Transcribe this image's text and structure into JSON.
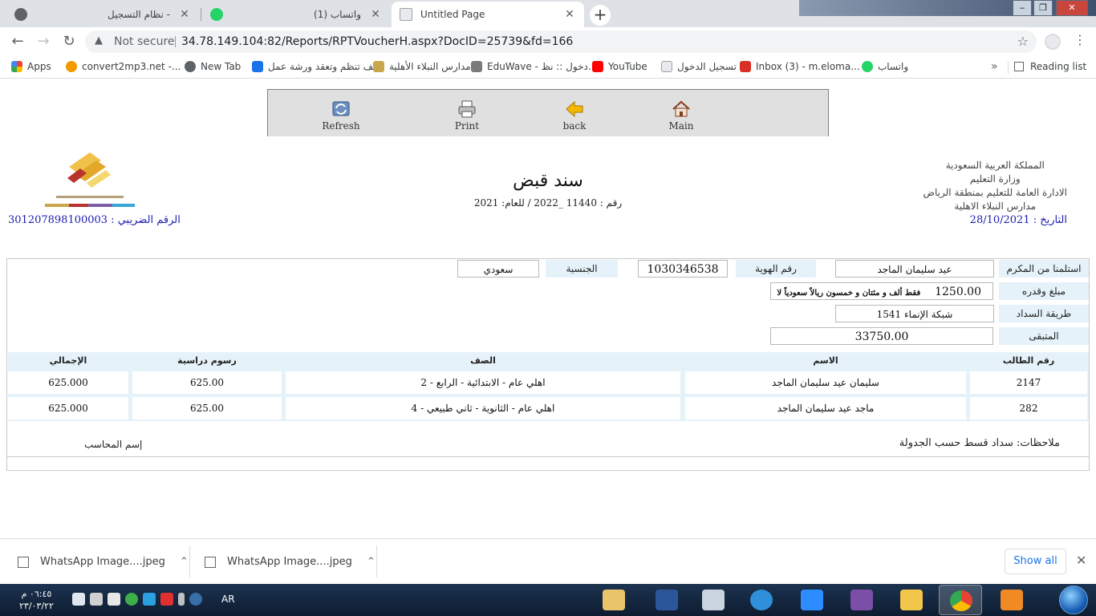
{
  "browser": {
    "tabs": [
      {
        "title": "نظام التسجيل -",
        "favicon_color": "#5f6368"
      },
      {
        "title": "(1) واتساب",
        "favicon_color": "#25d366"
      },
      {
        "title": "Untitled Page",
        "favicon_color": "#8ab4f8"
      }
    ],
    "address": {
      "security": "Not secure",
      "url": "34.78.149.104:82/Reports/RPTVoucherH.aspx?DocID=25739&fd=166"
    },
    "bookmarks": [
      {
        "label": "Apps",
        "color": "#ea4335"
      },
      {
        "label": "convert2mp3.net -...",
        "color": "#f29900"
      },
      {
        "label": "New Tab",
        "color": "#5f6368"
      },
      {
        "label": "كيف تنظم وتعقد ورشة عمل",
        "color": "#1a73e8"
      },
      {
        "label": "مدارس النبلاء الأهلية",
        "color": "#c8a64b"
      },
      {
        "label": "EduWave - دخول :: نظ...",
        "color": "#7a7a7a"
      },
      {
        "label": "YouTube",
        "color": "#ff0000"
      },
      {
        "label": "تسجيل الدخول",
        "color": "#9aa0a6"
      },
      {
        "label": "Inbox (3) - m.eloma...",
        "color": "#d93025"
      },
      {
        "label": "واتساب",
        "color": "#25d366"
      }
    ],
    "reading_list": "Reading list"
  },
  "report_toolbar": {
    "refresh": "Refresh",
    "print": "Print",
    "back": "back",
    "main": "Main"
  },
  "header": {
    "country": "المملكة العربية السعودية",
    "ministry": "وزارة التعليم",
    "directorate": "الادارة العامة للتعليم بمنطقة الرياض",
    "school": "مدارس النبلاء الاهلية",
    "date": "التاريخ : 28/10/2021",
    "title": "سند قبض",
    "number_line": "رقم : 11440 _2022 / للعام: 2021",
    "tax_number": "الرقم الضريبي : 301207898100003"
  },
  "voucher": {
    "received_from_label": "استلمنا من المكرم",
    "received_from": "عيد سليمان الماجد",
    "id_label": "رقم الهوية",
    "id_number": "1030346538",
    "nationality_label": "الجنسية",
    "nationality": "سعودي",
    "amount_label": "مبلغ وقدره",
    "amount": "1250.00",
    "amount_words": "فقط ألف و مئتان و خمسون ريالاً سعودياً لا غير.",
    "payment_method_label": "طريقة السداد",
    "payment_method": "شبكة الإنماء 1541",
    "remaining_label": "المتبقى",
    "remaining": "33750.00",
    "table": {
      "headers": {
        "student_no": "رقم الطالب",
        "name": "الاسم",
        "class": "الصف",
        "fees": "رسوم دراسية",
        "total": "الإجمالي"
      },
      "rows": [
        {
          "student_no": "2147",
          "name": "سليمان عيد سليمان الماجد",
          "class": "اهلي عام - الابتدائية - الرابع - 2",
          "fees": "625.00",
          "total": "625.000"
        },
        {
          "student_no": "282",
          "name": "ماجد عيد سليمان الماجد",
          "class": "اهلي عام - الثانوية - ثاني طبيعي - 4",
          "fees": "625.00",
          "total": "625.000"
        }
      ]
    },
    "notes": "ملاحظات: سداد قسط حسب الجدولة",
    "accountant": "إسم المحاسب"
  },
  "downloads": {
    "items": [
      "WhatsApp Image....jpeg",
      "WhatsApp Image....jpeg"
    ],
    "show_all": "Show all"
  },
  "taskbar": {
    "time": "٠٦:٤٥ م",
    "date": "٢٣/٠٣/٢٢",
    "lang": "AR"
  }
}
